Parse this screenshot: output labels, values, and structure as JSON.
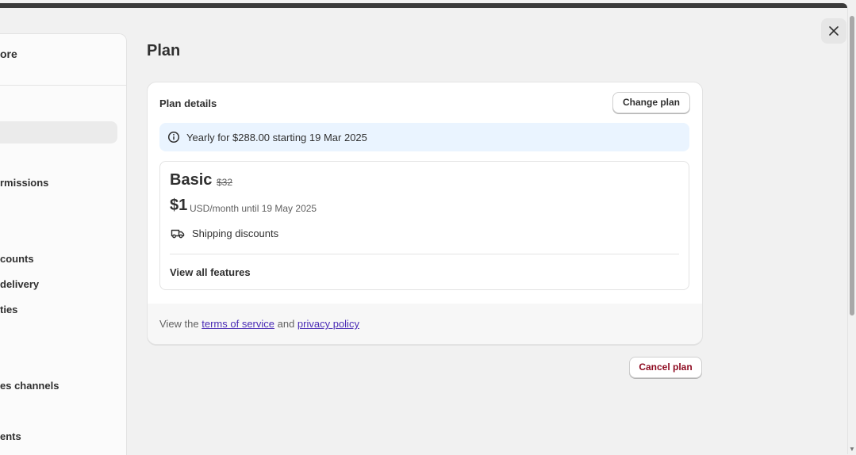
{
  "sidebar": {
    "store_name": "ore",
    "items": [
      {
        "label": "rmissions"
      },
      {
        "label": "counts"
      },
      {
        "label": " delivery"
      },
      {
        "label": "ties"
      },
      {
        "label": "es channels"
      },
      {
        "label": "ents"
      }
    ]
  },
  "page": {
    "title": "Plan"
  },
  "plan_card": {
    "title": "Plan details",
    "change_plan_label": "Change plan",
    "banner_text": "Yearly for $288.00 starting 19 Mar 2025",
    "plan_name": "Basic",
    "old_price": "$32",
    "price": "$1",
    "price_detail": "USD/month until 19 May 2025",
    "feature": "Shipping discounts",
    "view_all_label": "View all features",
    "footer": {
      "prefix": "View the ",
      "tos_link": "terms of service",
      "and": " and ",
      "privacy_link": "privacy policy"
    }
  },
  "cancel_plan_label": "Cancel plan",
  "icons": {
    "close": "close-icon",
    "info": "info-icon",
    "shipping": "delivery-truck-icon"
  },
  "colors": {
    "banner_bg": "#eaf4ff",
    "link": "#4a2cb5",
    "danger": "#8e0b21"
  }
}
